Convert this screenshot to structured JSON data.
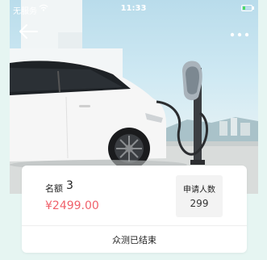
{
  "status_bar": {
    "carrier": "无服务",
    "time": "11:33",
    "battery_color": "#4cd964",
    "battery_level": 0.25
  },
  "nav": {
    "back_icon": "arrow-left-icon",
    "more_icon": "more-dots-icon"
  },
  "card": {
    "quota_label": "名额",
    "quota_value": "3",
    "price": "¥2499.00",
    "applicants_label": "申请人数",
    "applicants_count": "299",
    "status_text": "众测已结束"
  },
  "colors": {
    "price": "#f0616b",
    "background": "#e6f5f2"
  }
}
